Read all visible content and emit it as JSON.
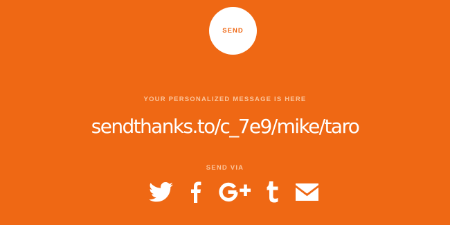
{
  "send_button": {
    "label": "SEND"
  },
  "message": {
    "heading": "YOUR PERSONALIZED MESSAGE IS HERE",
    "url": "sendthanks.to/c_7e9/mike/taro"
  },
  "share": {
    "heading": "SEND VIA",
    "channels": [
      {
        "name": "Twitter",
        "icon": "twitter-icon"
      },
      {
        "name": "Facebook",
        "icon": "facebook-icon"
      },
      {
        "name": "Google+",
        "icon": "google-plus-icon"
      },
      {
        "name": "Tumblr",
        "icon": "tumblr-icon"
      },
      {
        "name": "Email",
        "icon": "mail-icon"
      }
    ]
  },
  "colors": {
    "background": "#ef6814",
    "label_text": "#fbc49b",
    "foreground": "#ffffff"
  }
}
